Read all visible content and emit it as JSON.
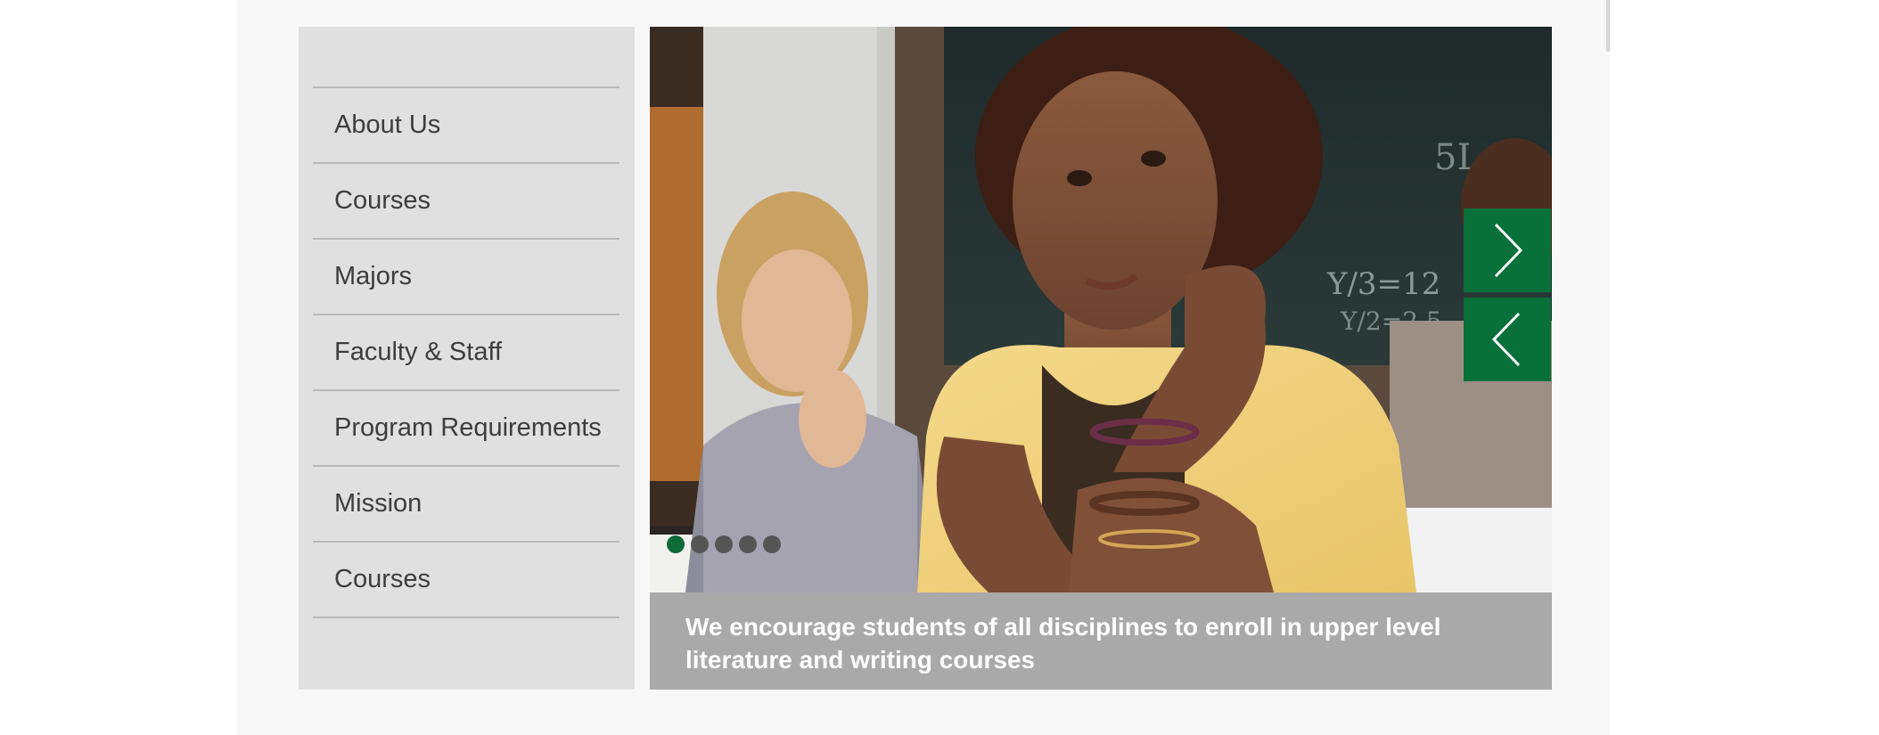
{
  "sidebar": {
    "items": [
      {
        "label": "About Us"
      },
      {
        "label": "Courses"
      },
      {
        "label": "Majors"
      },
      {
        "label": "Faculty & Staff"
      },
      {
        "label": "Program Requirements"
      },
      {
        "label": "Mission"
      },
      {
        "label": "Courses"
      }
    ]
  },
  "slider": {
    "caption": "We encourage students of all disciplines to enroll in upper level literature and writing courses",
    "next_icon": "chevron-right-icon",
    "prev_icon": "chevron-left-icon",
    "slide_count": 5,
    "active_slide": 1,
    "photo_description_icon": "classroom-photo"
  },
  "colors": {
    "accent": "#08703a",
    "caption_bg": "#a9a9a9",
    "sidebar_bg": "#e0e0e0"
  }
}
